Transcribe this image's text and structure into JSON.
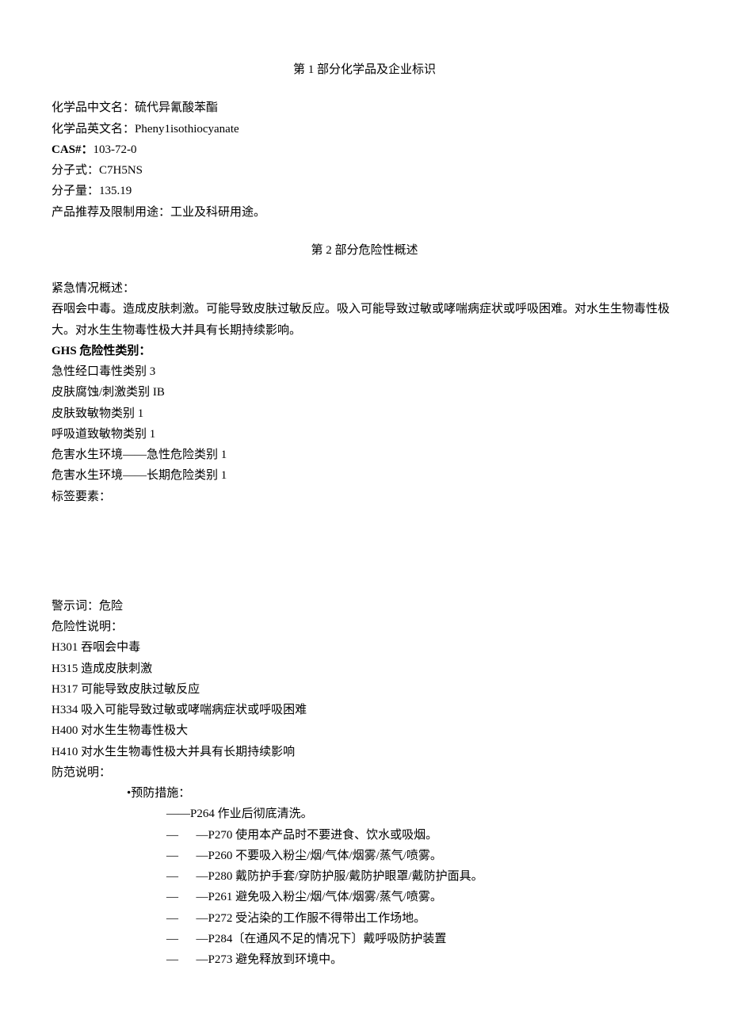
{
  "section1": {
    "title": "第 1 部分化学品及企业标识",
    "name_cn_label": "化学品中文名：",
    "name_cn": "硫代异氰酸苯酯",
    "name_en_label": "化学品英文名：",
    "name_en": "Pheny1isothiocyanate",
    "cas_label": "CAS#：",
    "cas": "103-72-0",
    "formula_label": "分子式：",
    "formula": "C7H5NS",
    "mw_label": "分子量：",
    "mw": "135.19",
    "use_label": "产品推荐及限制用途：",
    "use": "工业及科研用途。"
  },
  "section2": {
    "title": "第 2 部分危险性概述",
    "emergency_label": "紧急情况概述：",
    "emergency_text": "吞咽会中毒。造成皮肤刺激。可能导致皮肤过敏反应。吸入可能导致过敏或哮喘病症状或呼吸困难。对水生生物毒性极大。对水生生物毒性极大并具有长期持续影响。",
    "ghs_label": "GHS 危险性类别：",
    "ghs_list": [
      "急性经口毒性类别 3",
      "皮肤腐蚀/刺激类别 IB",
      "皮肤致敏物类别 1",
      "呼吸道致敏物类别 1",
      "危害水生环境——急性危险类别 1",
      "危害水生环境——长期危险类别 1"
    ],
    "label_elements_label": "标签要素：",
    "signal_label": "警示词：",
    "signal": "危险",
    "hazard_label": "危险性说明：",
    "hazard_list": [
      "H301 吞咽会中毒",
      "H315 造成皮肤刺激",
      "H317 可能导致皮肤过敏反应",
      "H334 吸入可能导致过敏或哮喘病症状或呼吸困难",
      "H400 对水生生物毒性极大",
      "H410 对水生生物毒性极大并具有长期持续影响"
    ],
    "precaution_label": "防范说明：",
    "prevention_header": "•预防措施：",
    "prevention_first": "——P264 作业后彻底清洗。",
    "prevention_list": [
      "—P270 使用本产品时不要进食、饮水或吸烟。",
      "—P260 不要吸入粉尘/烟/气体/烟雾/蒸气/喷雾。",
      "—P280 戴防护手套/穿防护服/戴防护眼罩/戴防护面具。",
      "—P261 避免吸入粉尘/烟/气体/烟雾/蒸气/喷雾。",
      "—P272 受沾染的工作服不得带出工作场地。",
      "—P284〔在通风不足的情况下〕戴呼吸防护装置",
      "—P273 避免释放到环境中。"
    ]
  }
}
